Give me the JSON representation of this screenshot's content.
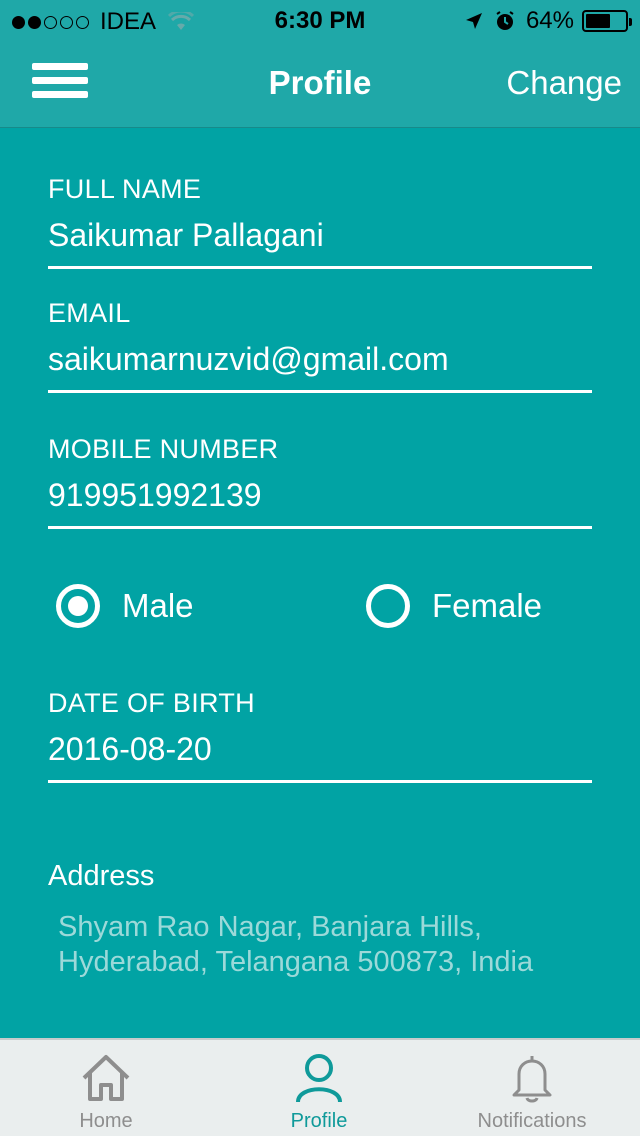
{
  "status_bar": {
    "carrier": "IDEA",
    "time": "6:30 PM",
    "battery_percent": "64%",
    "battery_level": 0.64,
    "signal_bars_filled": 2,
    "signal_bars_total": 5
  },
  "nav": {
    "title": "Profile",
    "right_action": "Change",
    "menu_icon": "hamburger-menu-icon"
  },
  "form": {
    "full_name": {
      "label": "FULL NAME",
      "value": "Saikumar Pallagani"
    },
    "email": {
      "label": "EMAIL",
      "value": "saikumarnuzvid@gmail.com"
    },
    "mobile": {
      "label": "MOBILE NUMBER",
      "value": "919951992139"
    },
    "gender": {
      "options": [
        "Male",
        "Female"
      ],
      "selected": "Male"
    },
    "dob": {
      "label": "DATE OF BIRTH",
      "value": "2016-08-20"
    },
    "address": {
      "label": "Address",
      "line1": "Shyam Rao Nagar, Banjara Hills,",
      "line2": "Hyderabad, Telangana 500873, India"
    }
  },
  "tab_bar": {
    "tabs": [
      {
        "label": "Home",
        "icon": "home-icon",
        "active": false
      },
      {
        "label": "Profile",
        "icon": "user-icon",
        "active": true
      },
      {
        "label": "Notifications",
        "icon": "bell-icon",
        "active": false
      }
    ]
  },
  "colors": {
    "background": "#01a3a4",
    "nav_background": "#1fa8a8",
    "address_text": "#9cd9d9",
    "tab_active": "#0f9a9a",
    "tab_inactive": "#8e8e8e"
  }
}
